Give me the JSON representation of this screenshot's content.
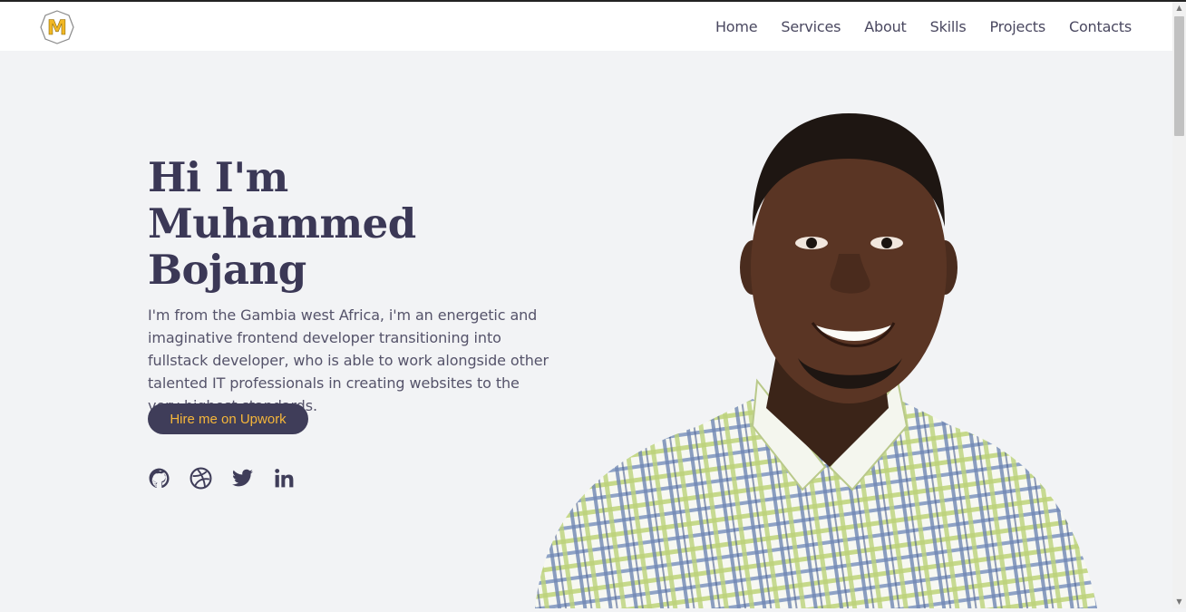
{
  "brand": {
    "logo_letter": "M"
  },
  "nav": {
    "items": [
      {
        "label": "Home"
      },
      {
        "label": "Services"
      },
      {
        "label": "About"
      },
      {
        "label": "Skills"
      },
      {
        "label": "Projects"
      },
      {
        "label": "Contacts"
      }
    ]
  },
  "hero": {
    "greeting": "Hi I'm",
    "name": "Muhammed Bojang",
    "description": "I'm from the Gambia west Africa, i'm an energetic and imaginative frontend developer transitioning into fullstack developer, who is able to work alongside other talented IT professionals in creating websites to the very highest standards.",
    "cta_label": "Hire me on Upwork"
  },
  "socials": [
    {
      "icon": "github-icon"
    },
    {
      "icon": "dribbble-icon"
    },
    {
      "icon": "twitter-icon"
    },
    {
      "icon": "linkedin-icon"
    }
  ],
  "colors": {
    "background": "#f2f3f5",
    "primary_dark": "#3f3d59",
    "accent": "#f5b63a"
  }
}
